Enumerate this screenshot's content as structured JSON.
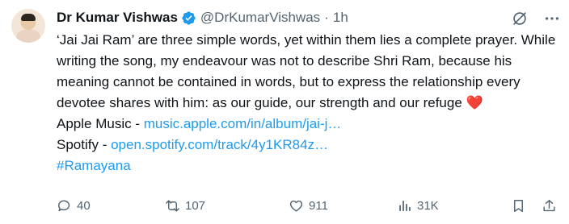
{
  "author": {
    "name": "Dr Kumar Vishwas",
    "handle": "@DrKumarVishwas",
    "separator": "·",
    "time": "1h"
  },
  "post": {
    "paragraph": "‘Jai Jai Ram’ are three simple words, yet within them lies a complete prayer. While writing the song, my endeavour was not to describe Shri Ram, because his meaning cannot be contained in words, but to express the relationship every devotee shares with him: as our guide, our strength and our refuge",
    "heart": "❤️",
    "apple_label": "Apple Music - ",
    "apple_link": "music.apple.com/in/album/jai-j…",
    "spotify_label": "Spotify - ",
    "spotify_link": "open.spotify.com/track/4y1KR84z…",
    "hashtag": "#Ramayana"
  },
  "actions": {
    "replies": "40",
    "reposts": "107",
    "likes": "911",
    "views": "31K"
  },
  "colors": {
    "text": "#0f1419",
    "secondary": "#536471",
    "link": "#1d9bf0",
    "verified": "#1d9bf0",
    "heart": "#f91880"
  },
  "icons": [
    "grok-icon",
    "more-icon",
    "reply-icon",
    "retweet-icon",
    "like-icon",
    "views-icon",
    "bookmark-icon",
    "share-icon",
    "verified-badge-icon"
  ]
}
